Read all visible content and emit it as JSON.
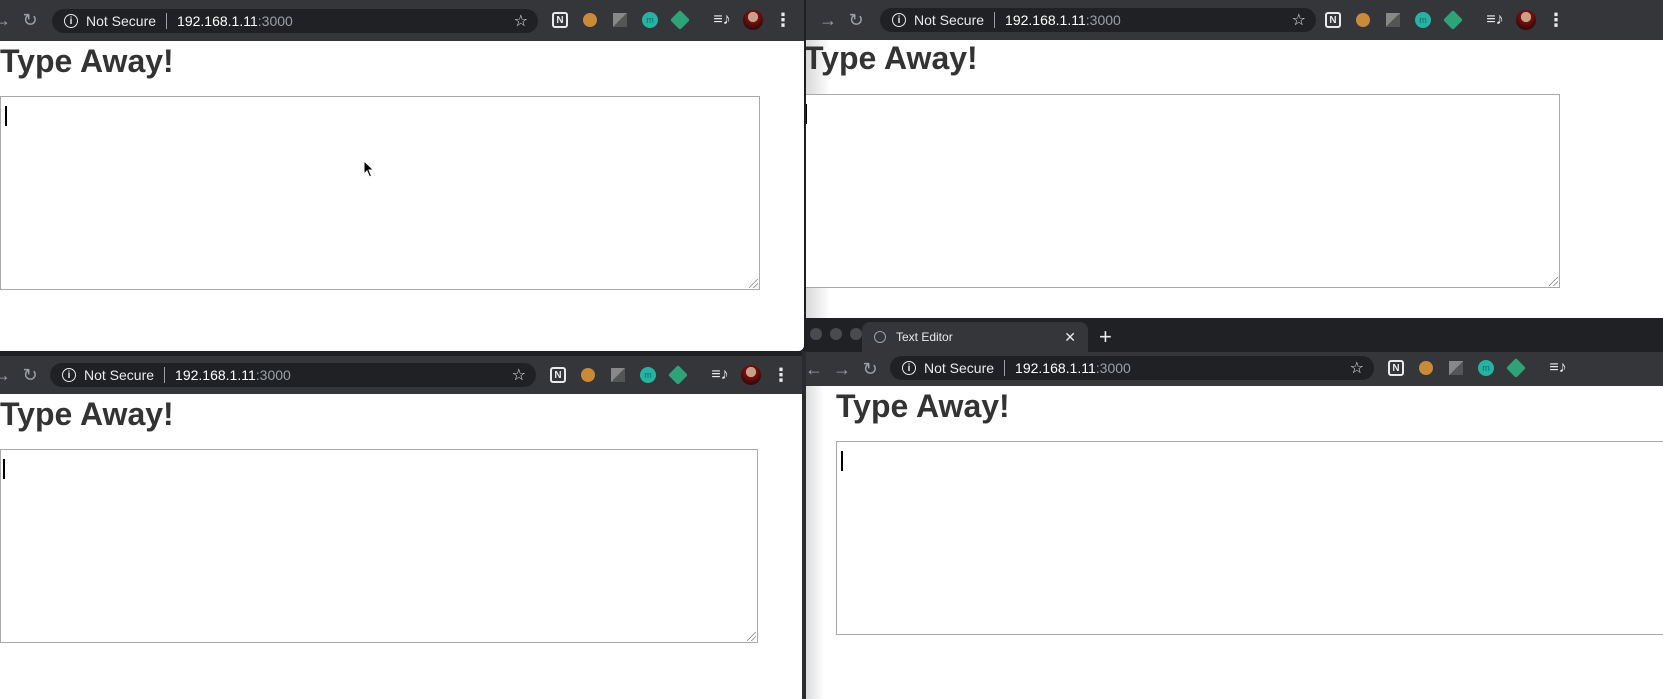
{
  "browser": {
    "security_label": "Not Secure",
    "url_host": "192.168.1.11",
    "url_port": ":3000",
    "star_icon": "☆",
    "notion_icon": "N",
    "extension_m": "m",
    "queue_icon": "≡♪",
    "menu_icon": "⋮",
    "back_icon": "←",
    "forward_icon": "→",
    "reload_icon": "↻"
  },
  "tab": {
    "title": "Text Editor",
    "close_icon": "✕",
    "new_tab_icon": "+"
  },
  "page": {
    "heading": "Type Away!"
  }
}
